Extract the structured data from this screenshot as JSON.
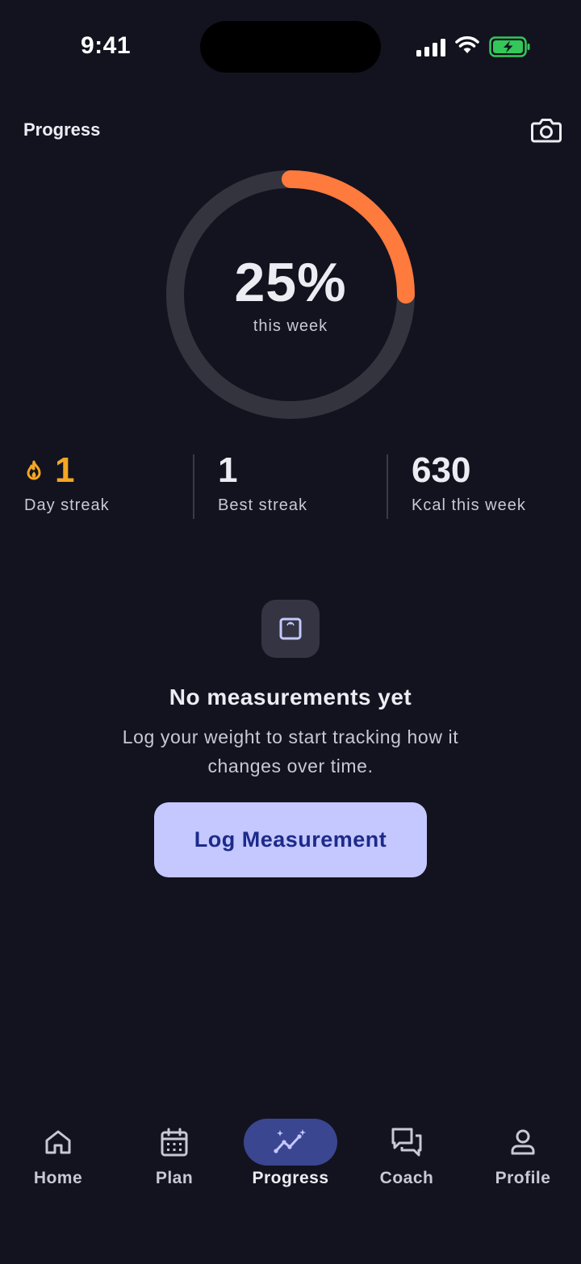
{
  "status_bar": {
    "time": "9:41"
  },
  "header": {
    "title": "Progress",
    "camera_icon": "camera-icon"
  },
  "progress_ring": {
    "percent_text": "25%",
    "percent_value": 0.25,
    "subtitle": "this week",
    "track_color": "#34343f",
    "fill_color": "#ff7a3d"
  },
  "stats": [
    {
      "value": "1",
      "label": "Day streak",
      "icon": "flame-icon",
      "accent": "#f5a623"
    },
    {
      "value": "1",
      "label": "Best streak"
    },
    {
      "value": "630",
      "label": "Kcal this week"
    }
  ],
  "empty_state": {
    "icon": "scale-icon",
    "title": "No measurements yet",
    "description": "Log your weight to start tracking how it changes over time.",
    "button_label": "Log Measurement"
  },
  "bottom_nav": {
    "items": [
      {
        "label": "Home",
        "icon": "home-icon",
        "active": false
      },
      {
        "label": "Plan",
        "icon": "calendar-icon",
        "active": false
      },
      {
        "label": "Progress",
        "icon": "trend-sparkle-icon",
        "active": true
      },
      {
        "label": "Coach",
        "icon": "chat-bubbles-icon",
        "active": false
      },
      {
        "label": "Profile",
        "icon": "person-icon",
        "active": false
      }
    ],
    "active_bg": "#3b4691"
  }
}
